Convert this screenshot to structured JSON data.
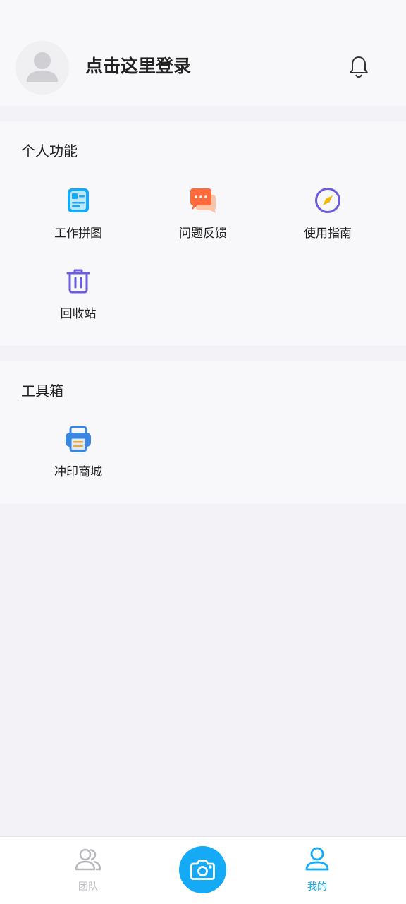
{
  "header": {
    "login_prompt": "点击这里登录"
  },
  "personal": {
    "title": "个人功能",
    "items": [
      {
        "label": "工作拼图",
        "icon": "work-puzzle-icon"
      },
      {
        "label": "问题反馈",
        "icon": "chat-feedback-icon"
      },
      {
        "label": "使用指南",
        "icon": "compass-icon"
      },
      {
        "label": "回收站",
        "icon": "trash-icon"
      }
    ]
  },
  "toolbox": {
    "title": "工具箱",
    "items": [
      {
        "label": "冲印商城",
        "icon": "printer-icon"
      }
    ]
  },
  "tabbar": {
    "tabs": [
      {
        "label": "团队",
        "icon": "team-icon",
        "active": false
      },
      {
        "label": "我的",
        "icon": "profile-icon",
        "active": true
      }
    ],
    "center_icon": "camera-icon"
  },
  "colors": {
    "accent": "#14aaf5",
    "inactive": "#b8b8be",
    "feedback": "#ff6a3d",
    "guide": "#6b5ce0",
    "trash": "#6b5ce0",
    "printer": "#3a86e0"
  }
}
